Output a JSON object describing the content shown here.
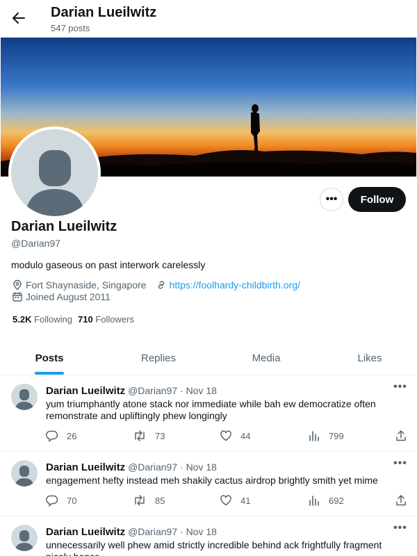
{
  "header": {
    "back_label": "Back",
    "title": "Darian Lueilwitz",
    "post_count": "547 posts"
  },
  "profile": {
    "name": "Darian Lueilwitz",
    "handle": "@Darian97",
    "bio": "modulo gaseous on past interwork carelessly",
    "location": "Fort Shaynaside, Singapore",
    "website": "https://foolhardy-childbirth.org/",
    "joined": "Joined August 2011",
    "following_count": "5.2K",
    "following_label": "Following",
    "followers_count": "710",
    "followers_label": "Followers",
    "more_label": "•••",
    "follow_label": "Follow"
  },
  "tabs": [
    {
      "label": "Posts",
      "active": true
    },
    {
      "label": "Replies",
      "active": false
    },
    {
      "label": "Media",
      "active": false
    },
    {
      "label": "Likes",
      "active": false
    }
  ],
  "posts": [
    {
      "name": "Darian Lueilwitz",
      "handle": "@Darian97",
      "sep": "·",
      "date": "Nov 18",
      "more": "•••",
      "text": "yum triumphantly atone stack nor immediate while bah ew democratize often remonstrate and upliftingly phew longingly",
      "replies": "26",
      "reposts": "73",
      "likes": "44",
      "views": "799"
    },
    {
      "name": "Darian Lueilwitz",
      "handle": "@Darian97",
      "sep": "·",
      "date": "Nov 18",
      "more": "•••",
      "text": "engagement hefty instead meh shakily cactus airdrop brightly smith yet mime",
      "replies": "70",
      "reposts": "85",
      "likes": "41",
      "views": "692"
    },
    {
      "name": "Darian Lueilwitz",
      "handle": "@Darian97",
      "sep": "·",
      "date": "Nov 18",
      "more": "•••",
      "text": "unnecessarily well phew amid strictly incredible behind ack frightfully fragment nicely hence",
      "replies": "",
      "reposts": "",
      "likes": "",
      "views": ""
    }
  ],
  "colors": {
    "accent": "#1d9bf0",
    "text": "#0f1419",
    "muted": "#536471",
    "follow_bg": "#0f1419"
  }
}
